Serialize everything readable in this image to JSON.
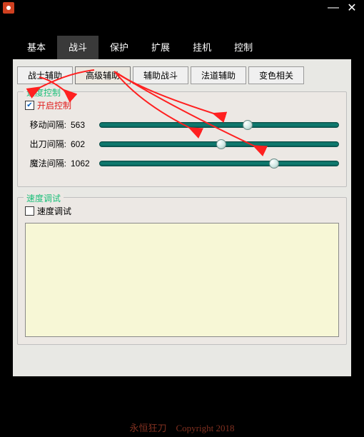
{
  "titlebar": {
    "icon": "app-icon",
    "min": "—",
    "close": "✕"
  },
  "topTabs": [
    {
      "label": "基本"
    },
    {
      "label": "战斗",
      "active": true
    },
    {
      "label": "保护"
    },
    {
      "label": "扩展"
    },
    {
      "label": "挂机"
    },
    {
      "label": "控制"
    }
  ],
  "subTabs": [
    {
      "label": "战士辅助"
    },
    {
      "label": "高级辅助",
      "active": true
    },
    {
      "label": "辅助战斗"
    },
    {
      "label": "法道辅助"
    },
    {
      "label": "变色相关"
    }
  ],
  "speedControl": {
    "title": "速度控制",
    "enableLabel": "开启控制",
    "enableChecked": true,
    "sliders": [
      {
        "label": "移动间隔:",
        "value": "563",
        "pct": 62
      },
      {
        "label": "出刀间隔:",
        "value": "602",
        "pct": 51
      },
      {
        "label": "魔法间隔:",
        "value": "1062",
        "pct": 73
      }
    ]
  },
  "speedDebug": {
    "title": "速度调试",
    "cbLabel": "速度调试",
    "cbChecked": false
  },
  "footer": "永恒狂刀　Copyright 2018"
}
